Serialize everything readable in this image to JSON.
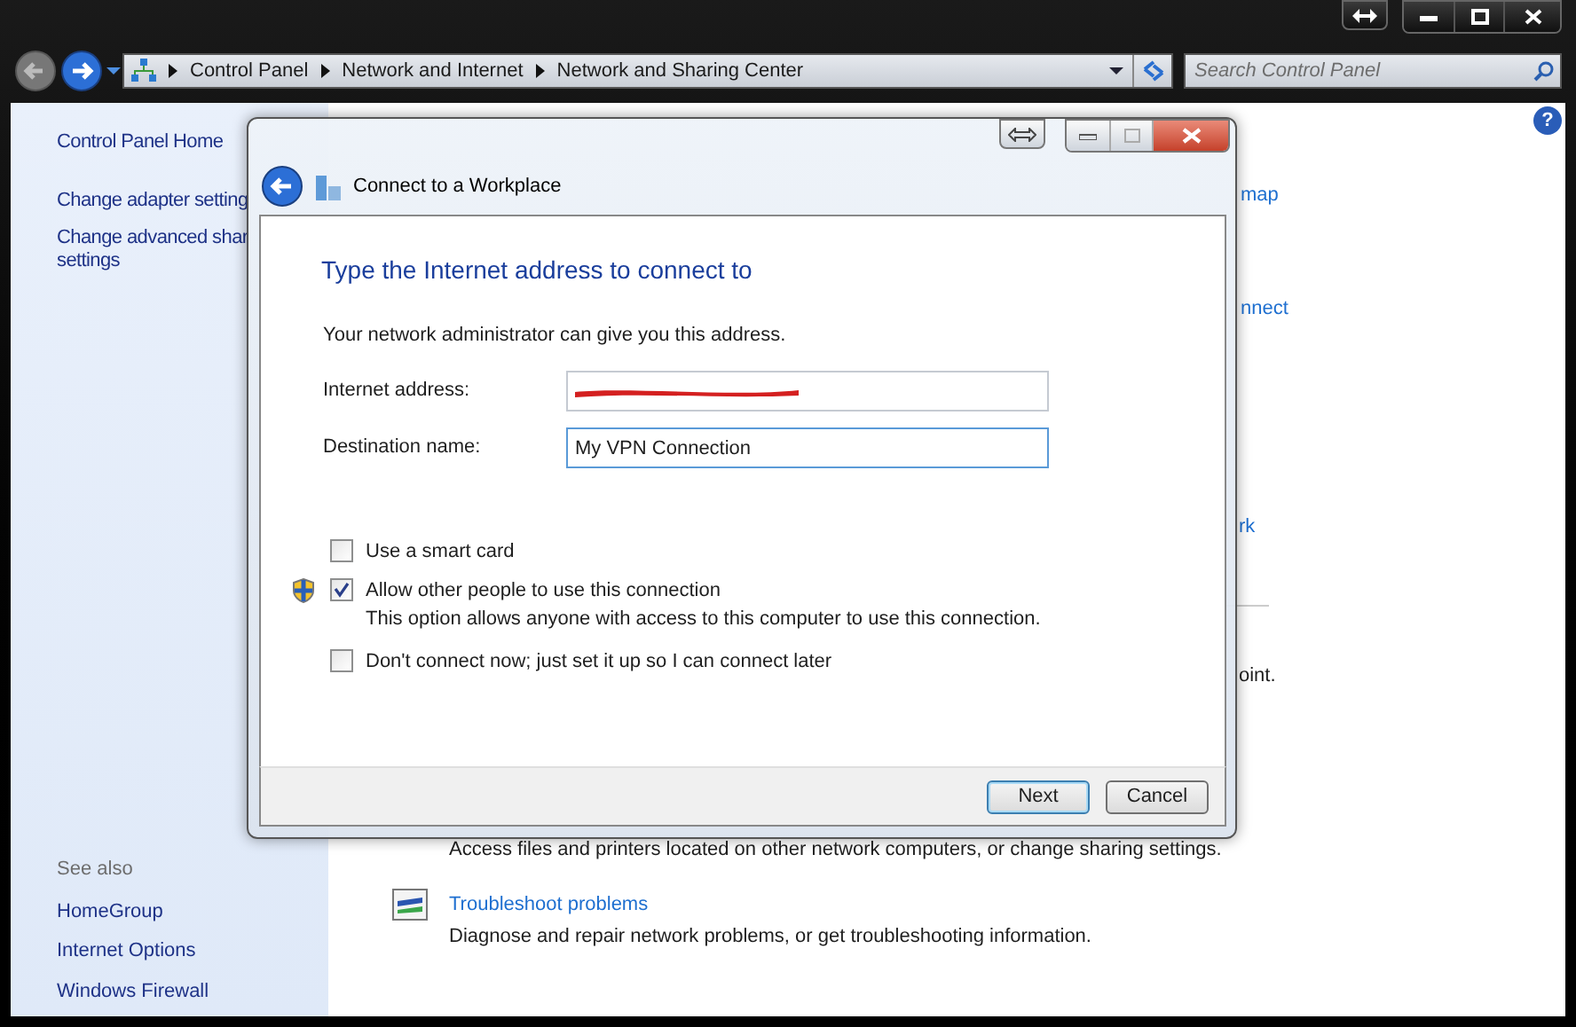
{
  "address_bar": {
    "breadcrumbs": [
      "Control Panel",
      "Network and Internet",
      "Network and Sharing Center"
    ]
  },
  "search": {
    "placeholder": "Search Control Panel"
  },
  "help_button": "?",
  "sidebar": {
    "items": [
      "Control Panel Home",
      "Change adapter setting"
    ],
    "advanced_item": [
      "Change advanced shar",
      "settings"
    ],
    "see_also_heading": "See also",
    "see_also": [
      "HomeGroup",
      "Internet Options",
      "Windows Firewall"
    ]
  },
  "background_fragments": {
    "map_link": "map",
    "connect_link": "nnect",
    "network_link": "rk",
    "point_text": "oint.",
    "sharing_text": "Access files and printers located on other network computers, or change sharing settings."
  },
  "troubleshoot": {
    "link": "Troubleshoot problems",
    "description": "Diagnose and repair network problems, or get troubleshooting information."
  },
  "dialog": {
    "title": "Connect to a Workplace",
    "heading": "Type the Internet address to connect to",
    "intro": "Your network administrator can give you this address.",
    "fields": [
      {
        "label": "Internet address:",
        "kind": "redacted",
        "focused": false
      },
      {
        "label": "Destination name:",
        "kind": "text",
        "value": "My VPN Connection",
        "focused": true
      }
    ],
    "options": [
      {
        "label": "Use a smart card",
        "checked": false,
        "shield": false
      },
      {
        "label": "Allow other people to use this connection",
        "checked": true,
        "shield": true,
        "note": "This option allows anyone with access to this computer to use this connection."
      },
      {
        "label": "Don't connect now; just set it up so I can connect later",
        "checked": false,
        "shield": false
      }
    ],
    "buttons": [
      {
        "label": "Next",
        "default": true
      },
      {
        "label": "Cancel",
        "default": false
      }
    ]
  }
}
